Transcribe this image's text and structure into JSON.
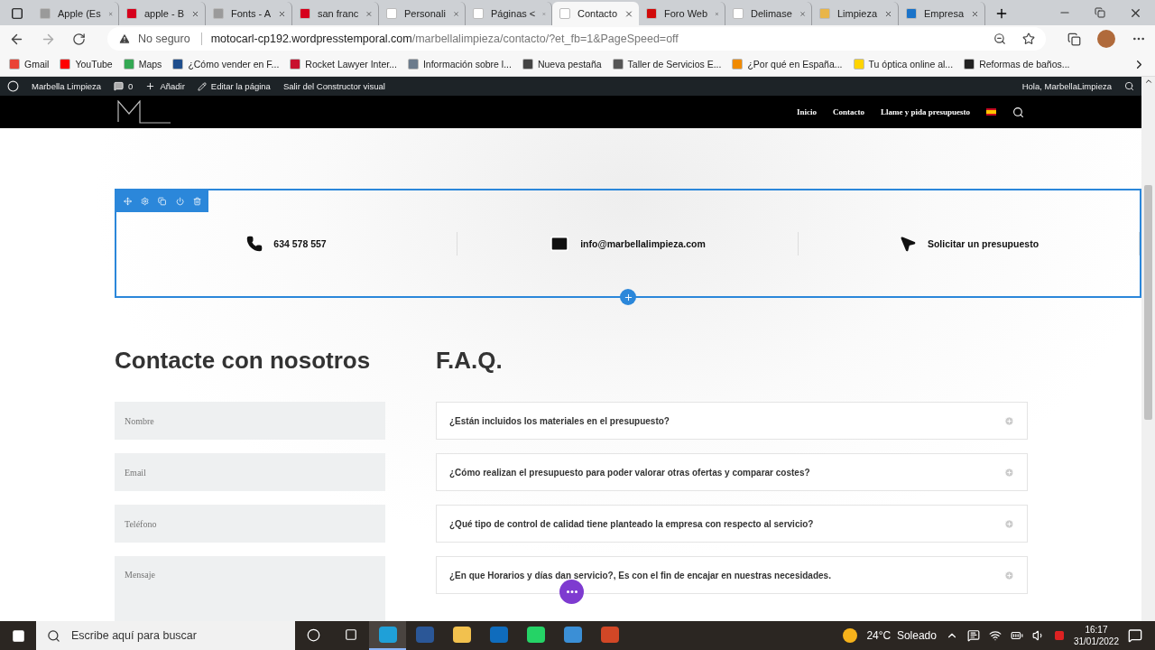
{
  "browser": {
    "tabs": [
      {
        "label": "Apple (Es",
        "kind": "apple",
        "selected": false
      },
      {
        "label": "apple - B",
        "kind": "red",
        "selected": false
      },
      {
        "label": "Fonts - A",
        "kind": "apple",
        "selected": false
      },
      {
        "label": "san franc",
        "kind": "red",
        "selected": false
      },
      {
        "label": "Personali",
        "kind": "page",
        "selected": false
      },
      {
        "label": "Páginas <",
        "kind": "page",
        "selected": false
      },
      {
        "label": "Contacto",
        "kind": "page",
        "selected": true
      },
      {
        "label": "Foro Web",
        "kind": "circle",
        "selected": false
      },
      {
        "label": "Delimase",
        "kind": "page",
        "selected": false
      },
      {
        "label": "Limpieza",
        "kind": "yellow",
        "selected": false
      },
      {
        "label": "Empresa",
        "kind": "blue",
        "selected": false
      }
    ],
    "security": "No seguro",
    "url_host": "motocarl-cp192.wordpresstemporal.com",
    "url_path": "/marbellalimpieza/contacto/?et_fb=1&PageSpeed=off",
    "bookmarks": [
      {
        "label": "Gmail",
        "color": "#ea4335"
      },
      {
        "label": "YouTube",
        "color": "#ff0000"
      },
      {
        "label": "Maps",
        "color": "#34a853"
      },
      {
        "label": "¿Cómo vender en F...",
        "color": "#1f4e8c"
      },
      {
        "label": "Rocket Lawyer Inter...",
        "color": "#c8102e"
      },
      {
        "label": "Información sobre l...",
        "color": "#6b7b8c"
      },
      {
        "label": "Nueva pestaña",
        "color": "#444444"
      },
      {
        "label": "Taller de Servicios E...",
        "color": "#555555"
      },
      {
        "label": "¿Por qué en España...",
        "color": "#f08a00"
      },
      {
        "label": "Tu óptica online al...",
        "color": "#ffd400"
      },
      {
        "label": "Reformas de baños...",
        "color": "#222222"
      }
    ]
  },
  "admin_bar": {
    "site": "Marbella Limpieza",
    "comments": "0",
    "add": "Añadir",
    "edit": "Editar la página",
    "exit": "Salir del Constructor visual",
    "greeting": "Hola, MarbellaLimpieza"
  },
  "nav": [
    {
      "label": "Inicio"
    },
    {
      "label": "Contacto"
    },
    {
      "label": "Llame y pida presupuesto"
    }
  ],
  "contact_strip": [
    {
      "kind": "phone",
      "text": "634 578 557"
    },
    {
      "kind": "mail",
      "text": "info@marbellalimpieza.com"
    },
    {
      "kind": "cursor",
      "text": "Solicitar un presupuesto"
    }
  ],
  "contact": {
    "title": "Contacte con nosotros",
    "fields": [
      {
        "placeholder": "Nombre"
      },
      {
        "placeholder": "Email"
      },
      {
        "placeholder": "Teléfono"
      },
      {
        "placeholder": "Mensaje",
        "kind": "textarea"
      }
    ]
  },
  "faq": {
    "title": "F.A.Q.",
    "items": [
      {
        "question": "¿Están incluidos los materiales en el presupuesto?",
        "expanded": false
      },
      {
        "question": "¿Cómo realizan el presupuesto para poder valorar otras ofertas y comparar costes?",
        "expanded": false
      },
      {
        "question": "¿Qué tipo de control de calidad tiene planteado la empresa con respecto al servicio?",
        "expanded": false
      },
      {
        "question": "¿En que Horarios y días dan servicio?, Es con el fin de encajar en nuestras necesidades.",
        "expanded": false
      }
    ]
  },
  "taskbar": {
    "search": "Escribe aquí para buscar",
    "apps": [
      {
        "kind": "edge",
        "active": true
      },
      {
        "kind": "word",
        "active": false
      },
      {
        "kind": "folder",
        "active": false
      },
      {
        "kind": "outlook",
        "active": false
      },
      {
        "kind": "whatsapp",
        "active": false
      },
      {
        "kind": "photos",
        "active": false
      },
      {
        "kind": "powerpoint",
        "active": false
      }
    ],
    "weather": "24°C  Soleado",
    "time": "16:17",
    "date": "31/01/2022"
  }
}
